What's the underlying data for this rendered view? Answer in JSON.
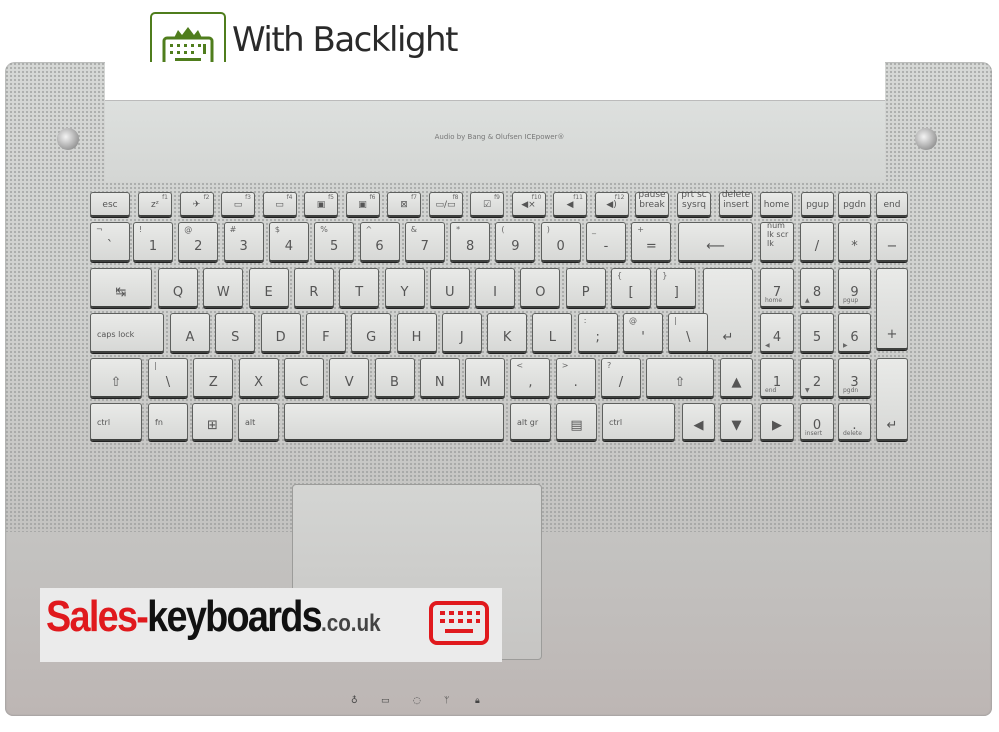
{
  "badge": {
    "text": "With Backlight",
    "icon": "backlit-keyboard-icon",
    "color": "#4f7d1c"
  },
  "audio_label": "Audio by Bang & Olufsen ICEpower®",
  "logo": {
    "part1": "Sales-",
    "part2": "keyboards",
    "part3": ".co.uk",
    "icon": "keyboard-icon",
    "red": "#e0191d"
  },
  "rows": {
    "fn": [
      [
        "esc",
        ""
      ],
      [
        "zᶻ",
        "f1"
      ],
      [
        "✈",
        "f2"
      ],
      [
        "▭",
        "f3"
      ],
      [
        "▭",
        "f4"
      ],
      [
        "▣",
        "f5"
      ],
      [
        "▣",
        "f6"
      ],
      [
        "⊠",
        "f7"
      ],
      [
        "▭/▭",
        "f8"
      ],
      [
        "☑",
        "f9"
      ],
      [
        "◀×",
        "f10"
      ],
      [
        "◀",
        "f11"
      ],
      [
        "◀)",
        "f12"
      ],
      [
        "pause break",
        ""
      ],
      [
        "prt sc sysrq",
        ""
      ],
      [
        "delete insert",
        ""
      ],
      [
        "home",
        ""
      ],
      [
        "pgup",
        ""
      ],
      [
        "pgdn",
        ""
      ],
      [
        "end",
        ""
      ]
    ],
    "num": [
      [
        "`",
        "¬"
      ],
      [
        "1",
        "!"
      ],
      [
        "2",
        "@"
      ],
      [
        "3",
        "#"
      ],
      [
        "4",
        "$"
      ],
      [
        "5",
        "%"
      ],
      [
        "6",
        "^"
      ],
      [
        "7",
        "&"
      ],
      [
        "8",
        "*"
      ],
      [
        "9",
        "("
      ],
      [
        "0",
        ")"
      ],
      [
        "-",
        "_"
      ],
      [
        "=",
        "+"
      ],
      [
        "⟵",
        ""
      ],
      [
        "num lk scr lk",
        ""
      ],
      [
        "/",
        ""
      ],
      [
        "*",
        ""
      ],
      [
        "−",
        ""
      ]
    ],
    "q": [
      [
        "↹",
        ""
      ],
      [
        "Q",
        ""
      ],
      [
        "W",
        ""
      ],
      [
        "E",
        ""
      ],
      [
        "R",
        ""
      ],
      [
        "T",
        ""
      ],
      [
        "Y",
        ""
      ],
      [
        "U",
        ""
      ],
      [
        "I",
        ""
      ],
      [
        "O",
        ""
      ],
      [
        "P",
        ""
      ],
      [
        "[",
        "{"
      ],
      [
        "]",
        "}"
      ],
      [
        "↵",
        ""
      ],
      [
        "7",
        "home"
      ],
      [
        "8",
        "▲"
      ],
      [
        "9",
        "pgup"
      ],
      [
        "+",
        ""
      ]
    ],
    "a": [
      [
        "caps lock",
        ""
      ],
      [
        "A",
        ""
      ],
      [
        "S",
        ""
      ],
      [
        "D",
        ""
      ],
      [
        "F",
        ""
      ],
      [
        "G",
        ""
      ],
      [
        "H",
        ""
      ],
      [
        "J",
        ""
      ],
      [
        "K",
        ""
      ],
      [
        "L",
        ""
      ],
      [
        ";",
        ":"
      ],
      [
        "'",
        "@"
      ],
      [
        "\\",
        "|"
      ],
      [
        "4",
        "◀"
      ],
      [
        "5",
        ""
      ],
      [
        "6",
        "▶"
      ]
    ],
    "z": [
      [
        "⇧",
        ""
      ],
      [
        "\\",
        "|"
      ],
      [
        "Z",
        ""
      ],
      [
        "X",
        ""
      ],
      [
        "C",
        ""
      ],
      [
        "V",
        ""
      ],
      [
        "B",
        ""
      ],
      [
        "N",
        ""
      ],
      [
        "M",
        ""
      ],
      [
        ",",
        "<"
      ],
      [
        ".",
        ">"
      ],
      [
        "/",
        "?"
      ],
      [
        "⇧",
        ""
      ],
      [
        "▲",
        ""
      ],
      [
        "1",
        "end"
      ],
      [
        "2",
        "▼"
      ],
      [
        "3",
        "pgdn"
      ],
      [
        "↵",
        ""
      ]
    ],
    "bottom": [
      [
        "ctrl",
        ""
      ],
      [
        "fn",
        ""
      ],
      [
        "⊞",
        ""
      ],
      [
        "alt",
        ""
      ],
      [
        "",
        ""
      ],
      [
        "alt gr",
        ""
      ],
      [
        "▤",
        ""
      ],
      [
        "ctrl",
        ""
      ],
      [
        "◀",
        ""
      ],
      [
        "▼",
        ""
      ],
      [
        "▶",
        ""
      ],
      [
        "0",
        "insert"
      ],
      [
        ".",
        "delete"
      ]
    ]
  },
  "status_leds": [
    "power-led-icon",
    "battery-led-icon",
    "hdd-led-icon",
    "wifi-led-icon",
    "lock-led-icon"
  ]
}
